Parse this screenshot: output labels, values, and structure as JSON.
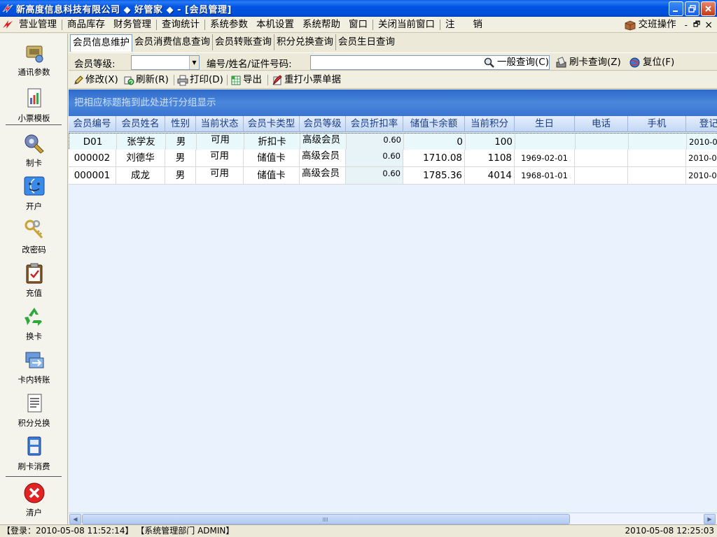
{
  "window": {
    "title": "新高度信息科技有限公司 ◆ 好管家 ◆ - [会员管理]"
  },
  "menu": {
    "items": [
      "营业管理",
      "商品库存",
      "财务管理",
      "查询统计",
      "系统参数",
      "本机设置",
      "系统帮助",
      "窗口",
      "关闭当前窗口",
      "注",
      "销"
    ],
    "shift_label": "交班操作",
    "mdi_min": "-",
    "mdi_restore": "🗗",
    "mdi_close": "×"
  },
  "sidebar": {
    "items": [
      {
        "label": "通讯参数",
        "icon": "network-settings-icon"
      },
      {
        "label": "小票模板",
        "icon": "receipt-template-icon"
      },
      {
        "label": "制卡",
        "icon": "make-card-icon"
      },
      {
        "label": "开户",
        "icon": "open-account-icon"
      },
      {
        "label": "改密码",
        "icon": "keys-icon"
      },
      {
        "label": "充值",
        "icon": "recharge-clipboard-icon"
      },
      {
        "label": "换卡",
        "icon": "recycle-icon"
      },
      {
        "label": "卡内转账",
        "icon": "transfer-icon"
      },
      {
        "label": "积分兑换",
        "icon": "points-document-icon"
      },
      {
        "label": "刷卡消费",
        "icon": "card-swipe-icon"
      },
      {
        "label": "清户",
        "icon": "close-account-icon"
      }
    ]
  },
  "tabs": [
    "会员信息维护",
    "会员消费信息查询",
    "会员转账查询",
    "积分兑换查询",
    "会员生日查询"
  ],
  "query": {
    "level_label": "会员等级:",
    "level_value": "",
    "search_label": "编号/姓名/证件号码:",
    "search_value": "",
    "general_query": "一般查询(C)",
    "card_query": "刷卡查询(Z)",
    "reset": "复位(F)"
  },
  "actions": {
    "edit": "修改(X)",
    "refresh": "刷新(R)",
    "print": "打印(D)",
    "export": "导出",
    "reprint": "重打小票单据"
  },
  "group_panel_text": "把相应标题拖到此处进行分组显示",
  "grid": {
    "columns": [
      "会员编号",
      "会员姓名",
      "性别",
      "当前状态",
      "会员卡类型",
      "会员等级",
      "会员折扣率",
      "储值卡余额",
      "当前积分",
      "生日",
      "电话",
      "手机",
      "登记日"
    ],
    "rows": [
      [
        "D01",
        "张学友",
        "男",
        "可用",
        "折扣卡",
        "高级会员",
        "0.60",
        "0",
        "100",
        "",
        "",
        "",
        "2010-0"
      ],
      [
        "000002",
        "刘德华",
        "男",
        "可用",
        "储值卡",
        "高级会员",
        "0.60",
        "1710.08",
        "1108",
        "1969-02-01",
        "",
        "",
        "2010-0"
      ],
      [
        "000001",
        "成龙",
        "男",
        "可用",
        "储值卡",
        "高级会员",
        "0.60",
        "1785.36",
        "4014",
        "1968-01-01",
        "",
        "",
        "2010-0"
      ]
    ]
  },
  "scrollbar": {
    "left_arrow": "◀",
    "right_arrow": "▶"
  },
  "status": {
    "login": "【登录：2010-05-08 11:52:14】 【系统管理部门  ADMIN】",
    "clock": "2010-05-08 12:25:03"
  },
  "colors": {
    "titlebar": "#0054e3",
    "group_panel": "#3a75d0",
    "header_text": "#1a3d8a",
    "selected_row": "#e8f8fb"
  }
}
